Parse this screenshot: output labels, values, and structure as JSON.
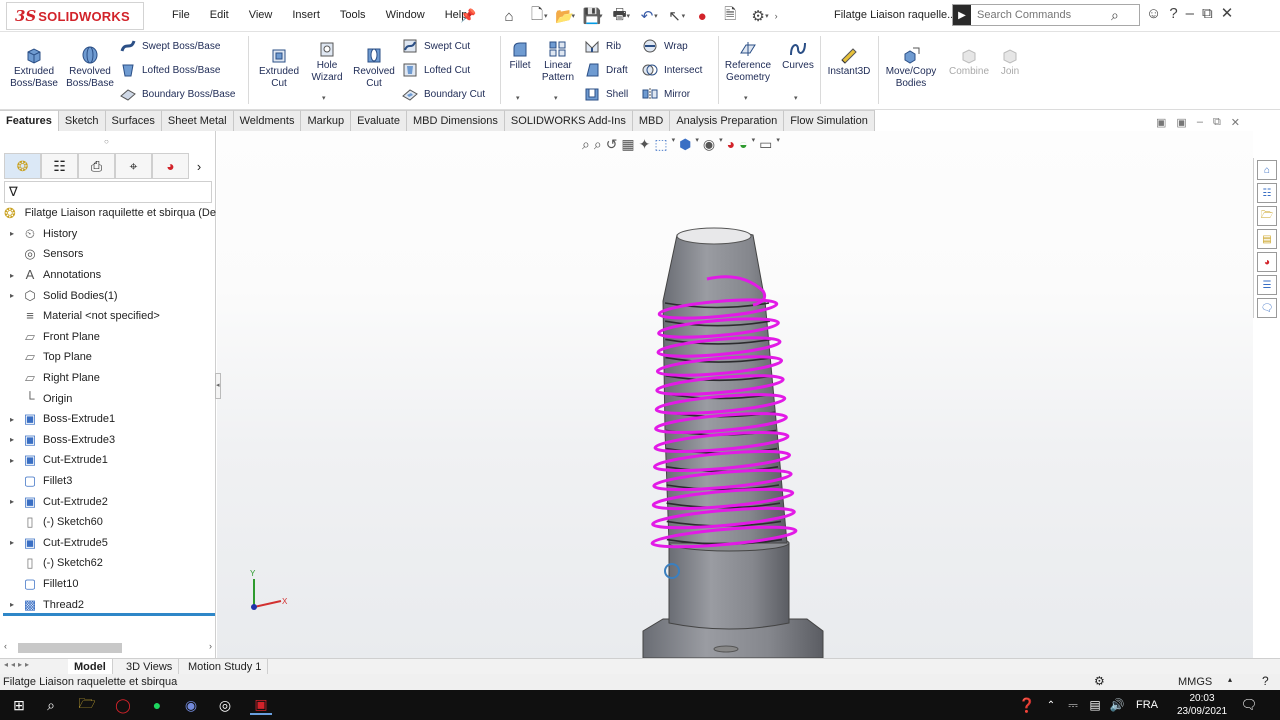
{
  "app": {
    "logo_ds": "3S",
    "logo_name": "SOLIDWORKS"
  },
  "menu": [
    "File",
    "Edit",
    "View",
    "Insert",
    "Tools",
    "Window",
    "Help"
  ],
  "document_title": "Filatge Liaison raquelle...",
  "search": {
    "placeholder": "Search Commands"
  },
  "ribbon": {
    "extruded_boss": "Extruded Boss/Base",
    "revolved_boss": "Revolved Boss/Base",
    "swept_boss": "Swept Boss/Base",
    "lofted_boss": "Lofted Boss/Base",
    "boundary_boss": "Boundary Boss/Base",
    "extruded_cut": "Extruded Cut",
    "hole_wizard": "Hole Wizard",
    "revolved_cut": "Revolved Cut",
    "swept_cut": "Swept Cut",
    "lofted_cut": "Lofted Cut",
    "boundary_cut": "Boundary Cut",
    "fillet": "Fillet",
    "linear_pattern": "Linear Pattern",
    "rib": "Rib",
    "draft": "Draft",
    "shell": "Shell",
    "wrap": "Wrap",
    "intersect": "Intersect",
    "mirror": "Mirror",
    "reference_geometry": "Reference Geometry",
    "curves": "Curves",
    "instant3d": "Instant3D",
    "move_copy": "Move/Copy Bodies",
    "combine": "Combine",
    "join": "Join"
  },
  "tabs": [
    "Features",
    "Sketch",
    "Surfaces",
    "Sheet Metal",
    "Weldments",
    "Markup",
    "Evaluate",
    "MBD Dimensions",
    "SOLIDWORKS Add-Ins",
    "MBD",
    "Analysis Preparation",
    "Flow Simulation"
  ],
  "tree": {
    "root": "Filatge Liaison raquilette et sbirqua  (De",
    "items": [
      {
        "label": "History",
        "expandable": true
      },
      {
        "label": "Sensors",
        "expandable": false
      },
      {
        "label": "Annotations",
        "expandable": true
      },
      {
        "label": "Solid Bodies(1)",
        "expandable": true
      },
      {
        "label": "Material <not specified>",
        "expandable": false
      },
      {
        "label": "Front Plane",
        "expandable": false
      },
      {
        "label": "Top Plane",
        "expandable": false
      },
      {
        "label": "Right Plane",
        "expandable": false
      },
      {
        "label": "Origin",
        "expandable": false
      },
      {
        "label": "Boss-Extrude1",
        "expandable": true
      },
      {
        "label": "Boss-Extrude3",
        "expandable": true
      },
      {
        "label": "Cut-Extrude1",
        "expandable": true
      },
      {
        "label": "Fillet3",
        "expandable": false
      },
      {
        "label": "Cut-Extrude2",
        "expandable": true
      },
      {
        "label": "(-) Sketch60",
        "expandable": false
      },
      {
        "label": "Cut-Extrude5",
        "expandable": true
      },
      {
        "label": "(-) Sketch62",
        "expandable": false
      },
      {
        "label": "Fillet10",
        "expandable": false
      },
      {
        "label": "Thread2",
        "expandable": true
      }
    ]
  },
  "bottom_tabs": [
    "Model",
    "3D Views",
    "Motion Study 1"
  ],
  "status": {
    "left": "Filatge Liaison raquelette et sbirqua",
    "units": "MMGS"
  },
  "triad": {
    "x": "X",
    "y": "Y"
  },
  "taskbar": {
    "lang": "FRA",
    "time": "20:03",
    "date": "23/09/2021"
  },
  "colors": {
    "helix": "#e21ae6",
    "accent": "#2e87c8",
    "brand": "#d2232a"
  }
}
